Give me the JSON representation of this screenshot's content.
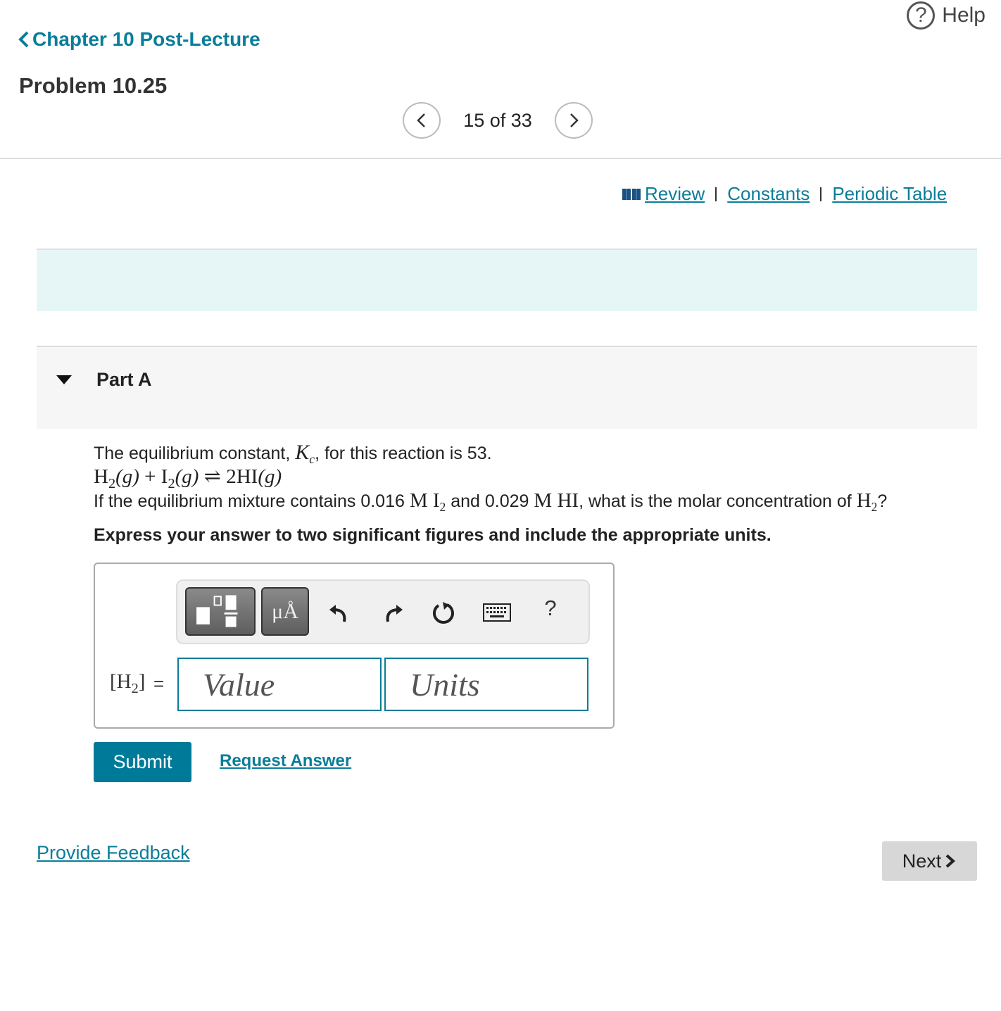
{
  "header": {
    "help_label": "Help",
    "back_label": "Chapter 10 Post-Lecture",
    "problem_title": "Problem 10.25",
    "pager_text": "15 of 33"
  },
  "resources": {
    "review": "Review",
    "constants": "Constants",
    "periodic_table": "Periodic Table"
  },
  "part": {
    "label": "Part A"
  },
  "question": {
    "line1_a": "The equilibrium constant, ",
    "kc_k": "K",
    "kc_sub": "c",
    "line1_b": ", for this reaction is 53.",
    "reaction": {
      "h": "H",
      "sub2": "2",
      "g1": "(g)",
      "plus": " + ",
      "i": "I",
      "g2": "(g)",
      "arrow": " ⇌ ",
      "product": "2HI",
      "g3": "(g)"
    },
    "line3_a": "If the equilibrium mixture contains 0.016 ",
    "m1": "M I",
    "line3_b": " and 0.029 ",
    "m2": "M HI",
    "line3_c": ", what is the molar concentration of ",
    "h2": "H",
    "line3_d": "?",
    "instruction": "Express your answer to two significant figures and include the appropriate units."
  },
  "answer": {
    "label_left": "[H",
    "label_right": "]",
    "label_sub": "2",
    "equals": "=",
    "value_placeholder": "Value",
    "units_placeholder": "Units",
    "units_button_label": "μÅ",
    "help_button_label": "?"
  },
  "actions": {
    "submit": "Submit",
    "request_answer": "Request Answer",
    "provide_feedback": "Provide Feedback",
    "next": "Next"
  },
  "colors": {
    "accent": "#0a7d99",
    "submit_bg": "#007a99",
    "teal_band": "#e6f6f6"
  }
}
